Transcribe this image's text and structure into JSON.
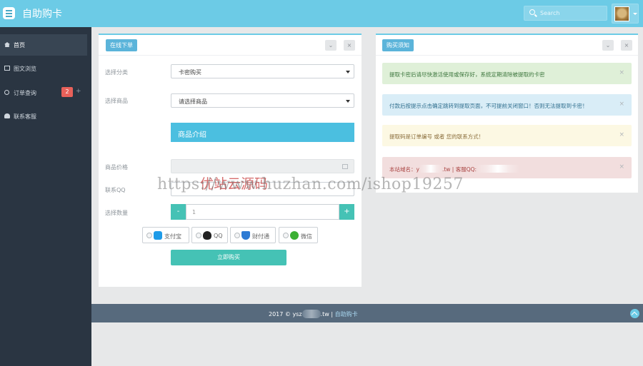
{
  "header": {
    "title": "自助购卡",
    "search_placeholder": "Search",
    "menu_icon": "hamburger-menu-icon",
    "avatar_icon": "user-avatar"
  },
  "sidebar": {
    "items": [
      {
        "label": "首页",
        "icon": "home-icon",
        "active": true
      },
      {
        "label": "图文浏览",
        "icon": "image-icon",
        "active": false
      },
      {
        "label": "订单查询",
        "icon": "search-icon",
        "active": false,
        "badge": "2",
        "extra": "+"
      },
      {
        "label": "联系客服",
        "icon": "user-icon",
        "active": false
      }
    ]
  },
  "order_panel": {
    "tag": "在线下单",
    "controls": [
      "⌄",
      "×"
    ],
    "fields": {
      "category_label": "选择分类",
      "category_value": "卡密购买",
      "product_label": "选择商品",
      "product_value": "请选择商品",
      "intro_label": "商品介绍",
      "price_label": "商品价格",
      "qq_label": "联系QQ",
      "qty_label": "选择数量",
      "qty_value": "1",
      "minus": "-",
      "plus": "+"
    },
    "payments": [
      {
        "label": "支付宝",
        "icon": "alipay-icon",
        "color": "#1e9be8"
      },
      {
        "label": "QQ",
        "icon": "qq-penguin-icon",
        "color": "#222222"
      },
      {
        "label": "财付通",
        "icon": "tenpay-shield-icon",
        "color": "#2d7bd4"
      },
      {
        "label": "微信",
        "icon": "wechat-icon",
        "color": "#3cb034"
      }
    ],
    "buy_label": "立即购买"
  },
  "notice_panel": {
    "tag": "购买须知",
    "controls": [
      "⌄",
      "×"
    ],
    "alerts": [
      {
        "text": "提取卡密后请尽快激活使用或保存好，系统定期清除被提取的卡密",
        "type": "success"
      },
      {
        "text": "付款后按提示点击确定跳转到提取页面，不可提前关闭窗口！否则无法提取到卡密！",
        "type": "info"
      },
      {
        "text": "提取码是订单编号 或者 您的联系方式！",
        "type": "warning"
      },
      {
        "text_prefix": "本站域名：y",
        "text_mid": ".tw | 客服QQ:",
        "type": "danger"
      }
    ],
    "close_mark": "×"
  },
  "watermark": {
    "cn": "优站云源码",
    "url": "https://www.huzhan.com/ishop19257"
  },
  "footer": {
    "prefix": "2017 © ysz",
    "suffix": ".tw",
    "separator": "|",
    "link": "自助购卡"
  },
  "colors": {
    "topbar": "#6ccbe6",
    "sidebar": "#2a3542",
    "primary": "#4bbfe0",
    "teal": "#45c2b5",
    "footer": "#576a7d"
  }
}
